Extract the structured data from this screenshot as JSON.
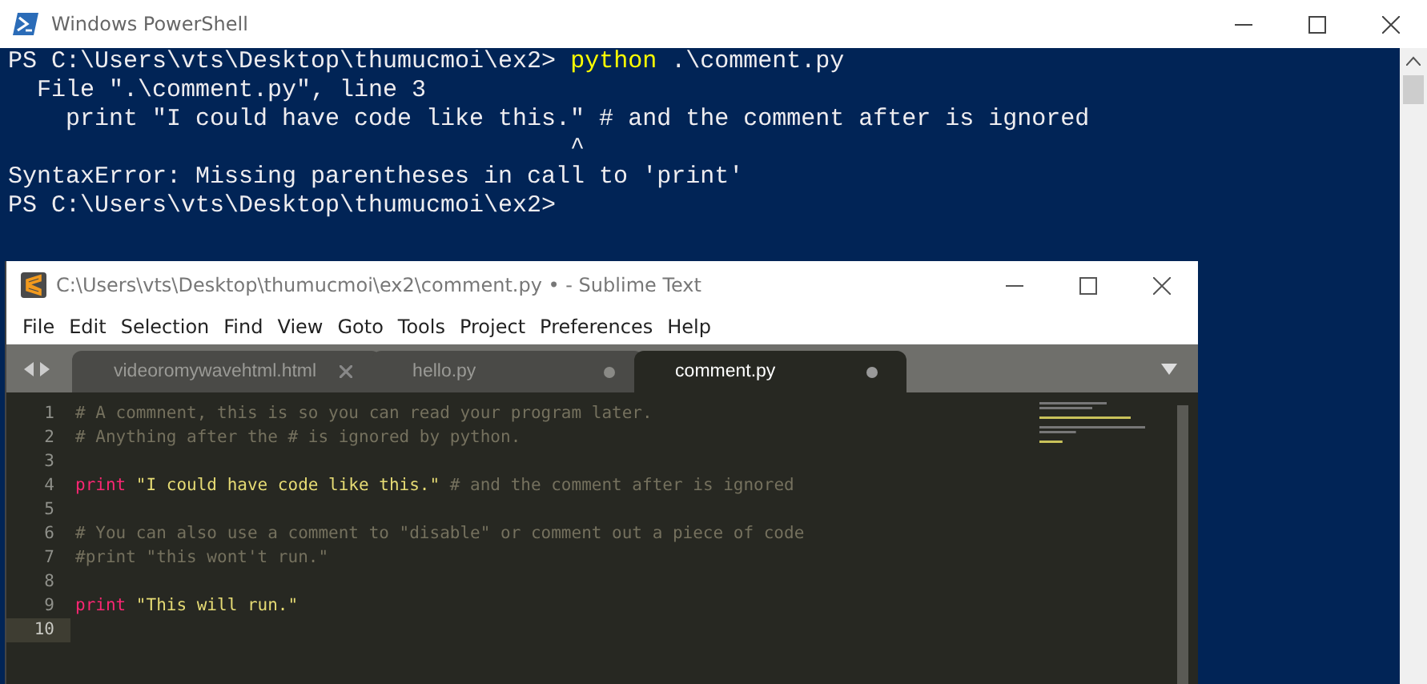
{
  "powershell": {
    "title": "Windows PowerShell",
    "lines": [
      [
        {
          "text": "PS C:\\Users\\vts\\Desktop\\thumucmoi\\ex2> ",
          "kind": "output"
        },
        {
          "text": "python",
          "kind": "command"
        },
        {
          "text": " .\\comment.py",
          "kind": "output"
        }
      ],
      [
        {
          "text": "  File \".\\comment.py\", line 3",
          "kind": "output"
        }
      ],
      [
        {
          "text": "    print \"I could have code like this.\" # and the comment after is ignored",
          "kind": "output"
        }
      ],
      [
        {
          "text": "                                       ^",
          "kind": "output"
        }
      ],
      [
        {
          "text": "SyntaxError: Missing parentheses in call to 'print'",
          "kind": "output"
        }
      ],
      [
        {
          "text": "PS C:\\Users\\vts\\Desktop\\thumucmoi\\ex2>",
          "kind": "output"
        }
      ]
    ]
  },
  "sublime": {
    "title": "C:\\Users\\vts\\Desktop\\thumucmoi\\ex2\\comment.py • - Sublime Text",
    "menu": [
      "File",
      "Edit",
      "Selection",
      "Find",
      "View",
      "Goto",
      "Tools",
      "Project",
      "Preferences",
      "Help"
    ],
    "tabs": [
      {
        "label": "videoromywavehtml.html",
        "selected": false,
        "modified": false
      },
      {
        "label": "hello.py",
        "selected": false,
        "modified": true
      },
      {
        "label": "comment.py",
        "selected": true,
        "modified": true
      }
    ],
    "lines": [
      {
        "number": "1",
        "current": false,
        "tokens": [
          {
            "text": "# A commnent, this is so you can read your program later.",
            "kind": "comment"
          }
        ]
      },
      {
        "number": "2",
        "current": false,
        "tokens": [
          {
            "text": "# Anything after the # is ignored by python.",
            "kind": "comment"
          }
        ]
      },
      {
        "number": "3",
        "current": false
      },
      {
        "number": "4",
        "current": false,
        "tokens": [
          {
            "text": "print",
            "kind": "keyword"
          },
          {
            "text": " \"I could have code like this.\"",
            "kind": "string"
          },
          {
            "text": " # and the comment after is ignored",
            "kind": "comment"
          }
        ]
      },
      {
        "number": "5",
        "current": false
      },
      {
        "number": "6",
        "current": false,
        "tokens": [
          {
            "text": "# You can also use a comment to \"disable\" or comment out a piece of code",
            "kind": "comment"
          }
        ]
      },
      {
        "number": "7",
        "current": false,
        "tokens": [
          {
            "text": "#print \"this wont't run.\"",
            "kind": "comment"
          }
        ]
      },
      {
        "number": "8",
        "current": false
      },
      {
        "number": "9",
        "current": false,
        "tokens": [
          {
            "text": "print",
            "kind": "keyword"
          },
          {
            "text": " \"This will run.\"",
            "kind": "string"
          }
        ]
      },
      {
        "number": "10",
        "current": true
      }
    ]
  }
}
